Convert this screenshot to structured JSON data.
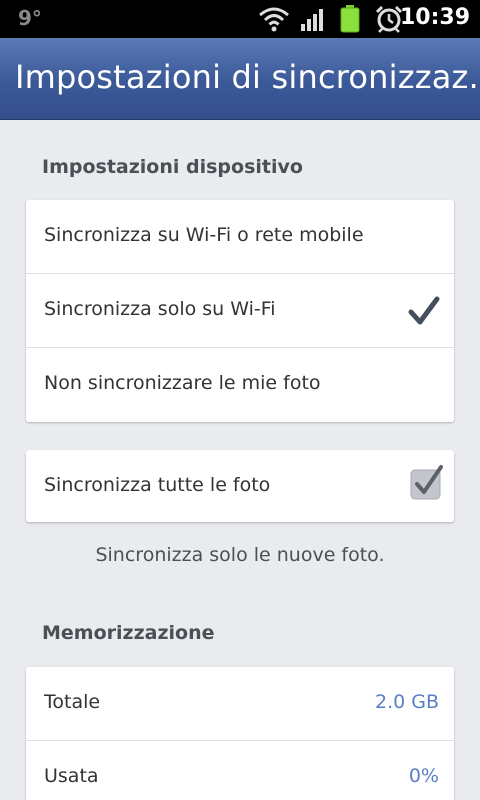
{
  "status_bar": {
    "notification": "9°",
    "time": "10:39",
    "icons": [
      "wifi-icon",
      "signal-icon",
      "battery-icon",
      "alarm-icon"
    ]
  },
  "header": {
    "title": "Impostazioni di sincronizzaz..."
  },
  "device_settings": {
    "heading": "Impostazioni dispositivo",
    "options": [
      {
        "label": "Sincronizza su Wi-Fi o rete mobile",
        "selected": false
      },
      {
        "label": "Sincronizza solo su Wi-Fi",
        "selected": true
      },
      {
        "label": "Non sincronizzare le mie foto",
        "selected": false
      }
    ],
    "sync_all": {
      "label": "Sincronizza tutte le foto",
      "checked": true
    },
    "note": "Sincronizza solo le nuove foto."
  },
  "storage": {
    "heading": "Memorizzazione",
    "rows": [
      {
        "label": "Totale",
        "value": "2.0 GB"
      },
      {
        "label": "Usata",
        "value": "0%"
      }
    ]
  },
  "colors": {
    "header": "#3b5998",
    "accent_value": "#5b7fc7",
    "background": "#e9ebee"
  }
}
